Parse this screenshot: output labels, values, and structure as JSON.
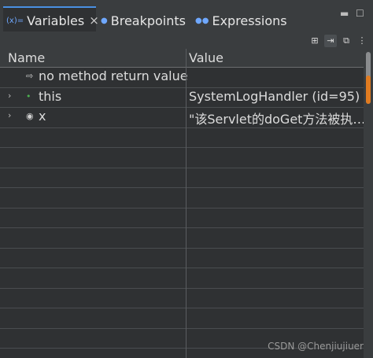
{
  "tabs": [
    {
      "label": "Variables",
      "icon": "variables-icon",
      "active": true
    },
    {
      "label": "Breakpoints",
      "icon": "breakpoints-icon",
      "active": false
    },
    {
      "label": "Expressions",
      "icon": "expressions-icon",
      "active": false
    }
  ],
  "table": {
    "columns": [
      "Name",
      "Value"
    ],
    "rows": [
      {
        "name": "no method return value",
        "value": "",
        "icon": "return-value-icon"
      },
      {
        "name": "this",
        "value": "SystemLogHandler  (id=95)",
        "icon": "field-icon",
        "expandable": true
      },
      {
        "name": "x",
        "value": "\"该Servlet的doGet方法被执…",
        "icon": "local-variable-icon",
        "expandable": true
      }
    ]
  },
  "watermark": "CSDN @Chenjiujiuer",
  "colors": {
    "accent": "#4a90e2",
    "scroll_marker": "#e07b20"
  }
}
